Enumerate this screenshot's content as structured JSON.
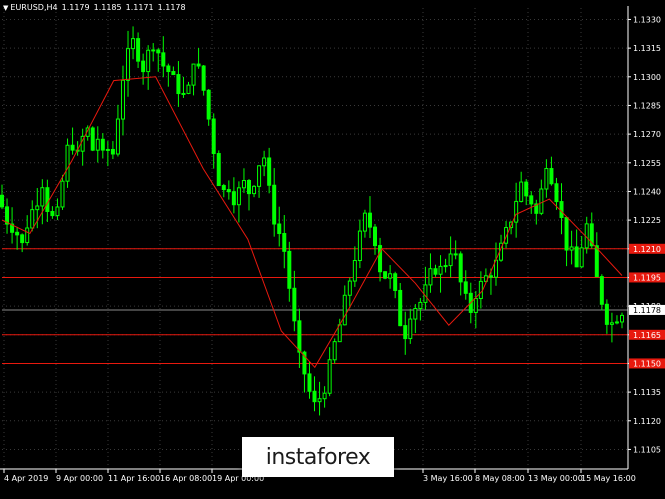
{
  "header": {
    "arrow": "▼",
    "symbol": "EURUSD,H4",
    "open": "1.1179",
    "high": "1.1185",
    "low": "1.1171",
    "close": "1.1178"
  },
  "price_scale": [
    "1.1330",
    "1.1315",
    "1.1300",
    "1.1285",
    "1.1270",
    "1.1255",
    "1.1240",
    "1.1225",
    "1.1210",
    "1.1195",
    "1.1180",
    "1.1165",
    "1.1150",
    "1.1135",
    "1.1120",
    "1.1105"
  ],
  "time_scale": [
    "4 Apr 2019",
    "9 Apr 00:00",
    "11 Apr 16:00",
    "16 Apr 08:00",
    "19 Apr 00:00",
    "3 May 16:00",
    "8 May 08:00",
    "13 May 00:00",
    "15 May 16:00"
  ],
  "levels": [
    {
      "label": "1.1210",
      "color": "#e8190e"
    },
    {
      "label": "1.1195",
      "color": "#e8190e"
    },
    {
      "label": "1.1165",
      "color": "#e8190e"
    },
    {
      "label": "1.1150",
      "color": "#e8190e"
    }
  ],
  "current_price": {
    "label": "1.1178",
    "color": "#ffffff"
  },
  "colors": {
    "background": "#000000",
    "bull_candle": "#00ff00",
    "bear_candle": "#00ff00",
    "moving_average": "#e8190e",
    "grid": "#3a3a3a"
  },
  "chart_data": {
    "type": "candlestick",
    "symbol": "EURUSD",
    "timeframe": "H4",
    "ylim": [
      1.11,
      1.1336
    ],
    "grid": true,
    "ohlc_last": {
      "open": 1.1179,
      "high": 1.1185,
      "low": 1.1171,
      "close": 1.1178
    },
    "horizontal_levels": [
      1.121,
      1.1195,
      1.1165,
      1.115
    ],
    "close_path": [
      1.1232,
      1.1225,
      1.1222,
      1.1218,
      1.1212,
      1.1223,
      1.123,
      1.1236,
      1.1245,
      1.1232,
      1.1226,
      1.1228,
      1.1245,
      1.1262,
      1.1265,
      1.1258,
      1.1268,
      1.1272,
      1.1262,
      1.1268,
      1.1258,
      1.1262,
      1.126,
      1.128,
      1.13,
      1.1311,
      1.1318,
      1.1312,
      1.1305,
      1.1312,
      1.1318,
      1.1313,
      1.1306,
      1.1303,
      1.1298,
      1.1294,
      1.129,
      1.1293,
      1.131,
      1.1303,
      1.1293,
      1.1278,
      1.1262,
      1.1246,
      1.124,
      1.1243,
      1.1237,
      1.124,
      1.1244,
      1.124,
      1.1246,
      1.1255,
      1.1258,
      1.124,
      1.1226,
      1.1218,
      1.1209,
      1.119,
      1.117,
      1.1152,
      1.1145,
      1.1135,
      1.1128,
      1.1132,
      1.1138,
      1.1148,
      1.116,
      1.117,
      1.1182,
      1.1194,
      1.1206,
      1.1216,
      1.1226,
      1.1222,
      1.1215,
      1.12,
      1.1196,
      1.1195,
      1.1185,
      1.1172,
      1.1166,
      1.1177,
      1.118,
      1.1182,
      1.1188,
      1.1196,
      1.12,
      1.1199,
      1.1203,
      1.121,
      1.1205,
      1.1192,
      1.1183,
      1.1178,
      1.1187,
      1.1191,
      1.1195,
      1.1198,
      1.1202,
      1.121,
      1.1218,
      1.1226,
      1.1236,
      1.1244,
      1.1238,
      1.1235,
      1.1228,
      1.124,
      1.1256,
      1.1248,
      1.1238,
      1.1225,
      1.1212,
      1.1207,
      1.12,
      1.1212,
      1.1222,
      1.1208,
      1.1194,
      1.1183,
      1.1174,
      1.1171,
      1.1175,
      1.1178
    ],
    "moving_average": [
      [
        0,
        1.1225
      ],
      [
        10,
        1.1218
      ],
      [
        25,
        1.1256
      ],
      [
        40,
        1.1298
      ],
      [
        55,
        1.13
      ],
      [
        72,
        1.1252
      ],
      [
        88,
        1.1215
      ],
      [
        100,
        1.1167
      ],
      [
        112,
        1.1148
      ],
      [
        124,
        1.1178
      ],
      [
        136,
        1.121
      ],
      [
        148,
        1.1192
      ],
      [
        160,
        1.117
      ],
      [
        172,
        1.1188
      ],
      [
        184,
        1.1228
      ],
      [
        196,
        1.1236
      ],
      [
        210,
        1.1215
      ],
      [
        222,
        1.1196
      ]
    ]
  },
  "watermark": {
    "brand": "instaforex"
  }
}
